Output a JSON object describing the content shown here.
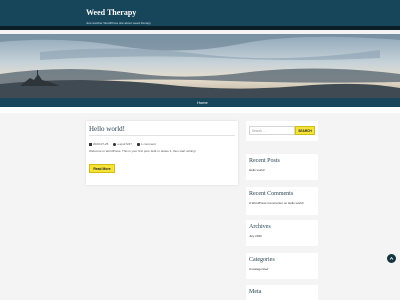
{
  "header": {
    "site_title": "Weed Therapy",
    "tagline": "Just another WordPress site about weed therapy"
  },
  "nav": {
    "items": [
      {
        "label": "Home"
      }
    ]
  },
  "post": {
    "title": "Hello world!",
    "date": "2020-07-25",
    "author": "u-spot7227",
    "comments": "1 comment",
    "excerpt": "Welcome to WordPress. This is your first post. Edit or delete it, then start writing!",
    "read_more_label": "Read More"
  },
  "sidebar": {
    "search": {
      "placeholder": "Search ...",
      "button_label": "SEARCH"
    },
    "recent_posts": {
      "title": "Recent Posts",
      "items": [
        "Hello world!"
      ]
    },
    "recent_comments": {
      "title": "Recent Comments",
      "items": [
        "A WordPress Commenter on Hello world!"
      ]
    },
    "archives": {
      "title": "Archives",
      "items": [
        "July 2020"
      ]
    },
    "categories": {
      "title": "Categories",
      "items": [
        "Uncategorized"
      ]
    },
    "meta": {
      "title": "Meta"
    }
  },
  "icons": {
    "calendar": "calendar-icon",
    "user": "user-icon",
    "comment": "comment-icon",
    "scroll_top": "chevron-up-icon"
  },
  "colors": {
    "header_bg": "#17465b",
    "accent": "#f6e33a",
    "page_bg": "#f4f4f4"
  }
}
